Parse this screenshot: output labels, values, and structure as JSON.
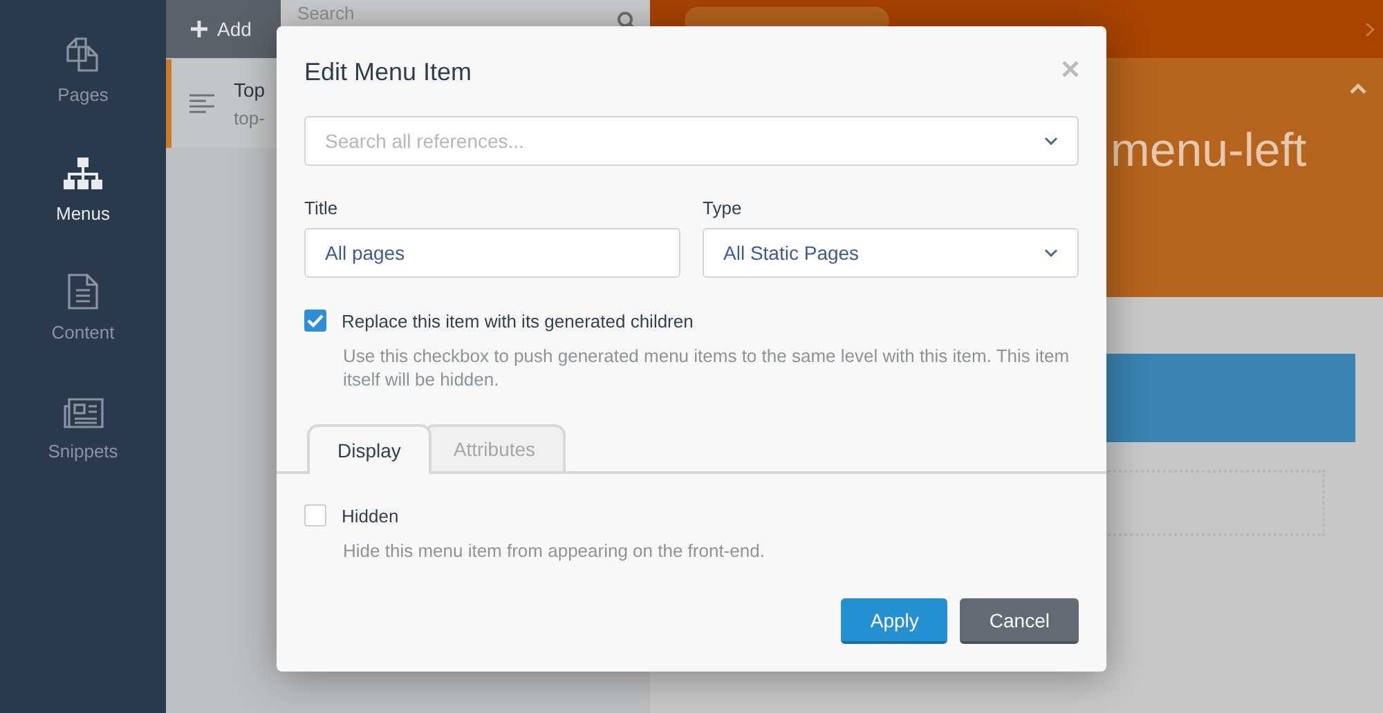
{
  "sidebar": {
    "items": [
      {
        "label": "Pages",
        "kind": "pages",
        "selected": false
      },
      {
        "label": "Menus",
        "kind": "menus",
        "selected": true
      },
      {
        "label": "Content",
        "kind": "content",
        "selected": false
      },
      {
        "label": "Snippets",
        "kind": "snippets",
        "selected": false
      }
    ]
  },
  "toolbar": {
    "add_button": "Add",
    "search": {
      "placeholder": "Search"
    }
  },
  "menu_list": [
    {
      "title": "Top",
      "subtitle": "top-",
      "selected": true
    }
  ],
  "editor": {
    "title": "menu-left"
  },
  "dialog": {
    "title": "Edit Menu Item",
    "reference": {
      "placeholder": "Search all references..."
    },
    "title_field": {
      "label": "Title",
      "value": "All pages"
    },
    "type_field": {
      "label": "Type",
      "value": "All Static Pages"
    },
    "replace_option": {
      "label": "Replace this item with its generated children",
      "checked": true,
      "help": "Use this checkbox to push generated menu items to the same level with this item. This item itself will be hidden."
    },
    "tabs": [
      {
        "label": "Display",
        "selected": true
      },
      {
        "label": "Attributes",
        "selected": false
      }
    ],
    "hidden_option": {
      "label": "Hidden",
      "checked": false,
      "help": "Hide this menu item from appearing on the front-end."
    },
    "buttons": [
      {
        "label": "Apply",
        "kind": "primary"
      },
      {
        "label": "Cancel",
        "kind": "secondary"
      }
    ]
  }
}
